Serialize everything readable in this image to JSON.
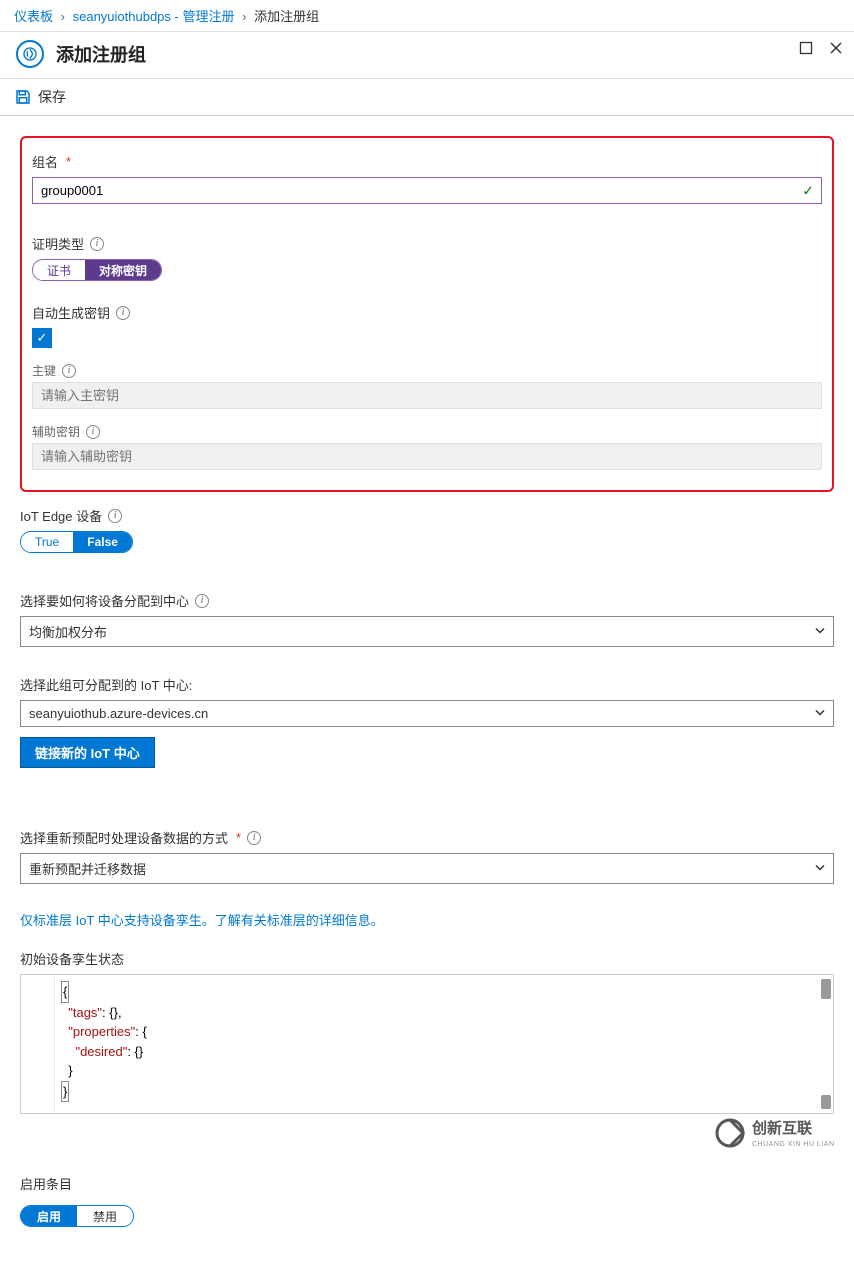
{
  "breadcrumb": {
    "dashboard": "仪表板",
    "resource": "seanyuiothubdps - 管理注册",
    "current": "添加注册组"
  },
  "panel": {
    "title": "添加注册组"
  },
  "toolbar": {
    "save": "保存"
  },
  "group_name": {
    "label": "组名",
    "value": "group0001"
  },
  "cert_type": {
    "label": "证明类型",
    "option_cert": "证书",
    "option_key": "对称密钥"
  },
  "auto_gen": {
    "label": "自动生成密钥",
    "checked": true
  },
  "primary_key": {
    "label": "主键",
    "placeholder": "请输入主密钥"
  },
  "secondary_key": {
    "label": "辅助密钥",
    "placeholder": "请输入辅助密钥"
  },
  "iot_edge": {
    "label": "IoT Edge 设备",
    "option_true": "True",
    "option_false": "False"
  },
  "allocation": {
    "label": "选择要如何将设备分配到中心",
    "value": "均衡加权分布"
  },
  "iot_center": {
    "label": "选择此组可分配到的 IoT 中心:",
    "value": "seanyuiothub.azure-devices.cn",
    "link_button": "链接新的 IoT 中心"
  },
  "reprovision": {
    "label": "选择重新预配时处理设备数据的方式",
    "value": "重新预配并迁移数据"
  },
  "twin_note": "仅标准层 IoT 中心支持设备孪生。了解有关标准层的详细信息。",
  "twin_state": {
    "label": "初始设备孪生状态",
    "code": {
      "l1a": "{",
      "l2a": "\"tags\"",
      "l2b": ": {},",
      "l3a": "\"properties\"",
      "l3b": ": {",
      "l4a": "\"desired\"",
      "l4b": ": {}",
      "l5": "}",
      "l6": "}"
    }
  },
  "enable_entry": {
    "label": "启用条目",
    "option_on": "启用",
    "option_off": "禁用"
  },
  "watermark": {
    "brand": "创新互联",
    "sub": "CHUANG XIN HU LIAN"
  }
}
